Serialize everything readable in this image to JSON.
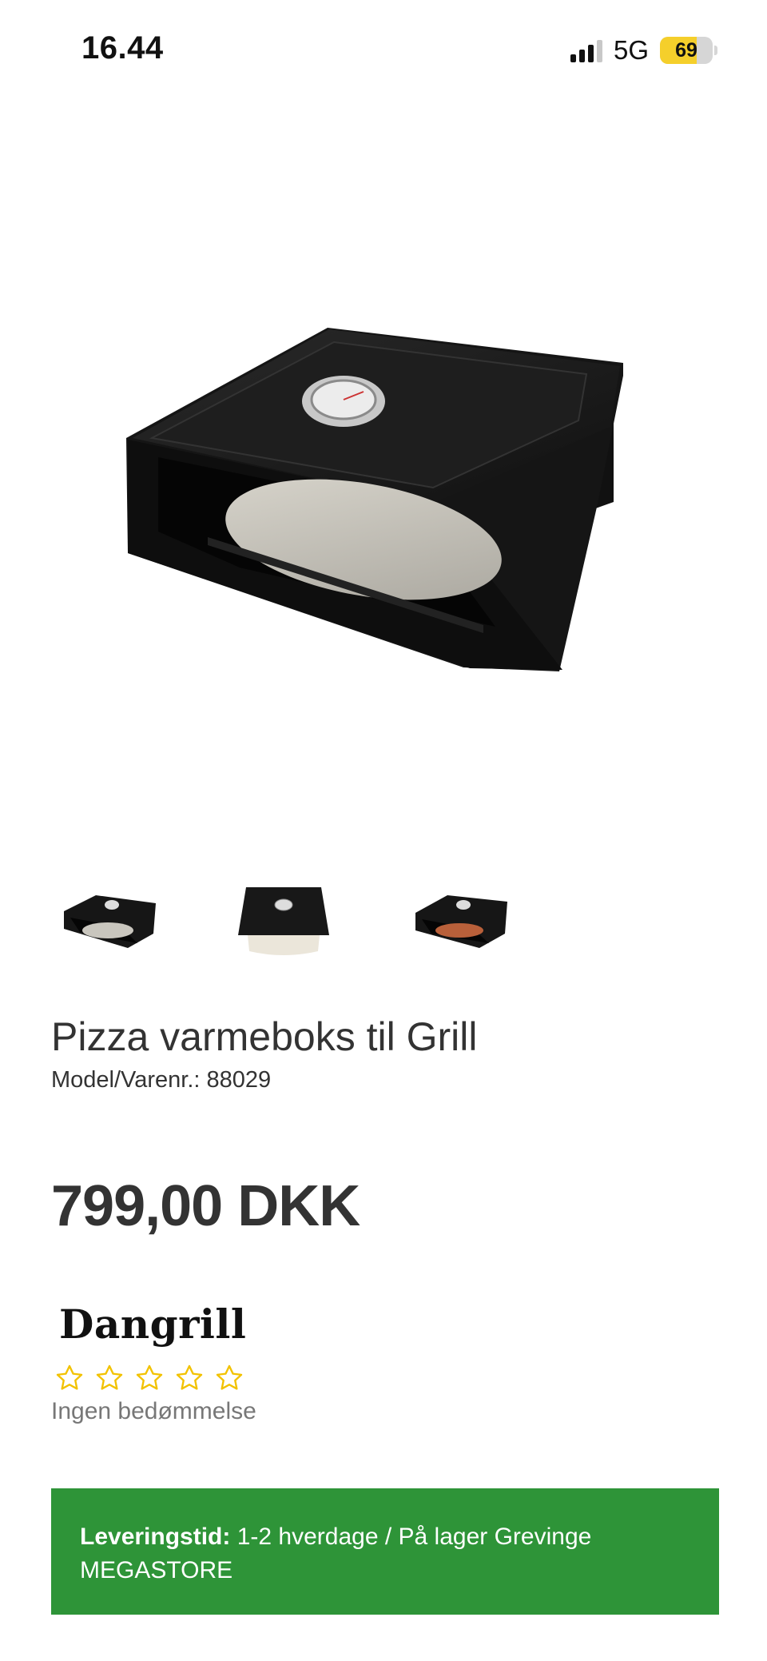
{
  "status_bar": {
    "time": "16.44",
    "network": "5G",
    "battery": "69",
    "battery_level": 0.69
  },
  "product": {
    "title": "Pizza varmeboks til Grill",
    "model": "Model/Varenr.: 88029",
    "price": "799,00 DKK",
    "brand": "Dangrill",
    "rating_stars": 5,
    "rating_text": "Ingen bedømmelse"
  },
  "gallery": {
    "thumbnails": [
      "thumbnail-1",
      "thumbnail-2",
      "thumbnail-3"
    ]
  },
  "delivery": {
    "label": "Leveringstid:",
    "text": "1-2 hverdage / På lager Grevinge MEGASTORE"
  },
  "colors": {
    "delivery_bg": "#2e9438",
    "star": "#f2c200",
    "battery": "#f5cf2b"
  }
}
